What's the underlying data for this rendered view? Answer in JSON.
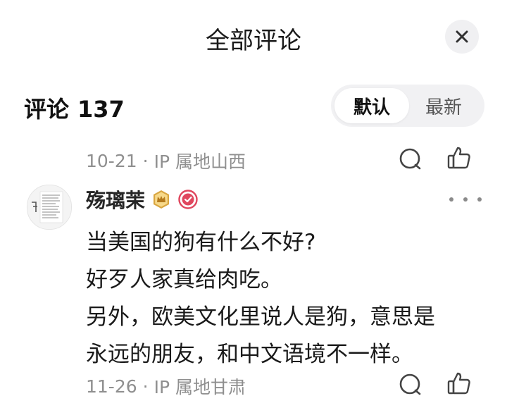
{
  "header": {
    "title": "全部评论"
  },
  "comments_section": {
    "label": "评论",
    "count": "137",
    "sort_options": [
      {
        "label": "默认",
        "active": true
      },
      {
        "label": "最新",
        "active": false
      }
    ]
  },
  "previous_comment": {
    "date": "10-21",
    "separator": "·",
    "location": "IP 属地山西"
  },
  "comment": {
    "username": "殇璃茉",
    "body_lines": [
      "当美国的狗有什么不好?",
      "好歹人家真给肉吃。",
      "另外，欧美文化里说人是狗，意思是",
      "永远的朋友，和中文语境不一样。"
    ],
    "date": "11-26",
    "separator": "·",
    "location": "IP 属地甘肃"
  },
  "icons": {
    "close": "close-icon",
    "reply": "comment-bubble-icon",
    "like": "thumbs-up-icon",
    "more": "more-horizontal-icon",
    "badge_gold": "crown-badge-icon",
    "badge_verified": "verified-check-icon"
  },
  "colors": {
    "text_primary": "#1a1a1a",
    "text_meta": "#8f8f8f",
    "toggle_bg": "#f1f1f3",
    "close_bg": "#f0f0f2",
    "badge_gold": "#d9a640",
    "badge_verified": "#e0475e"
  }
}
